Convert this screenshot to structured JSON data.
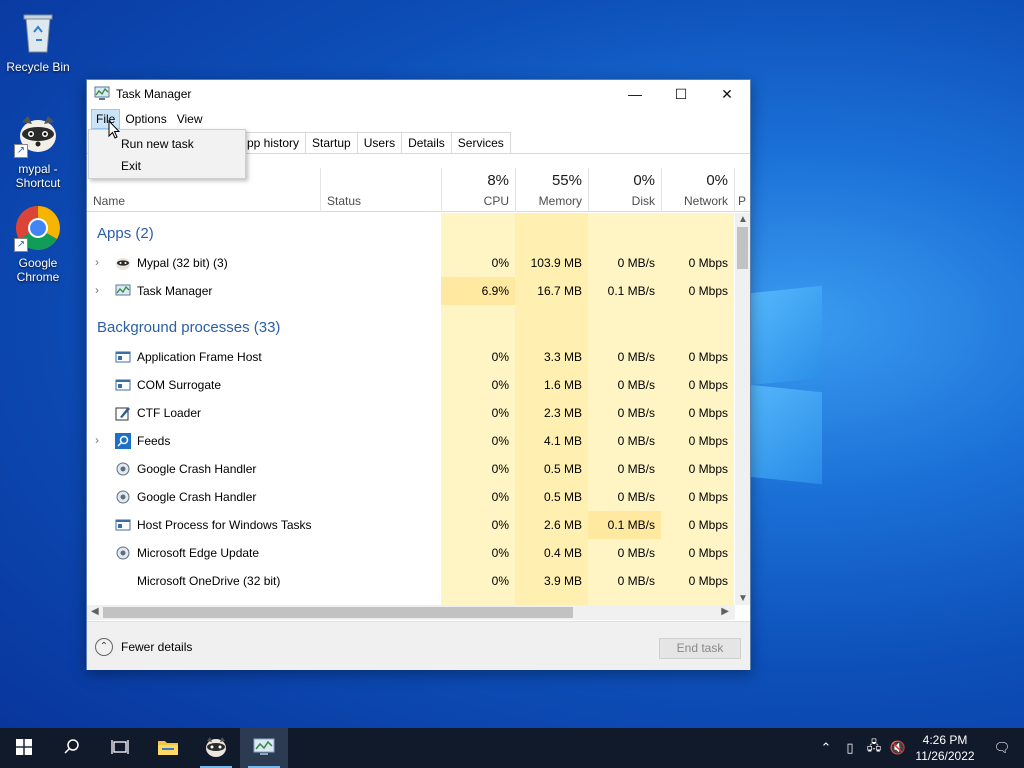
{
  "desktop": {
    "icons": [
      {
        "label": "Recycle Bin"
      },
      {
        "label": "mypal - Shortcut"
      },
      {
        "label": "Google Chrome"
      }
    ]
  },
  "window": {
    "title": "Task Manager",
    "menu": [
      "File",
      "Options",
      "View"
    ],
    "tabs": [
      "pp history",
      "Startup",
      "Users",
      "Details",
      "Services"
    ],
    "file_menu": [
      "Run new task",
      "Exit"
    ]
  },
  "columns": {
    "name": "Name",
    "status": "Status",
    "cpu": {
      "pct": "8%",
      "label": "CPU"
    },
    "memory": {
      "pct": "55%",
      "label": "Memory"
    },
    "disk": {
      "pct": "0%",
      "label": "Disk"
    },
    "network": {
      "pct": "0%",
      "label": "Network"
    },
    "extra": "P"
  },
  "groups": {
    "apps": "Apps (2)",
    "background": "Background processes (33)"
  },
  "rows": [
    {
      "name": "Mypal (32 bit) (3)",
      "cpu": "0%",
      "mem": "103.9 MB",
      "disk": "0 MB/s",
      "net": "0 Mbps"
    },
    {
      "name": "Task Manager",
      "cpu": "6.9%",
      "mem": "16.7 MB",
      "disk": "0.1 MB/s",
      "net": "0 Mbps"
    },
    {
      "name": "Application Frame Host",
      "cpu": "0%",
      "mem": "3.3 MB",
      "disk": "0 MB/s",
      "net": "0 Mbps"
    },
    {
      "name": "COM Surrogate",
      "cpu": "0%",
      "mem": "1.6 MB",
      "disk": "0 MB/s",
      "net": "0 Mbps"
    },
    {
      "name": "CTF Loader",
      "cpu": "0%",
      "mem": "2.3 MB",
      "disk": "0 MB/s",
      "net": "0 Mbps"
    },
    {
      "name": "Feeds",
      "cpu": "0%",
      "mem": "4.1 MB",
      "disk": "0 MB/s",
      "net": "0 Mbps"
    },
    {
      "name": "Google Crash Handler",
      "cpu": "0%",
      "mem": "0.5 MB",
      "disk": "0 MB/s",
      "net": "0 Mbps"
    },
    {
      "name": "Google Crash Handler",
      "cpu": "0%",
      "mem": "0.5 MB",
      "disk": "0 MB/s",
      "net": "0 Mbps"
    },
    {
      "name": "Host Process for Windows Tasks",
      "cpu": "0%",
      "mem": "2.6 MB",
      "disk": "0.1 MB/s",
      "net": "0 Mbps"
    },
    {
      "name": "Microsoft Edge Update",
      "cpu": "0%",
      "mem": "0.4 MB",
      "disk": "0 MB/s",
      "net": "0 Mbps"
    },
    {
      "name": "Microsoft OneDrive (32 bit)",
      "cpu": "0%",
      "mem": "3.9 MB",
      "disk": "0 MB/s",
      "net": "0 Mbps"
    }
  ],
  "footer": {
    "fewer_details": "Fewer details",
    "end_task": "End task"
  },
  "taskbar": {
    "time": "4:26 PM",
    "date": "11/26/2022"
  }
}
